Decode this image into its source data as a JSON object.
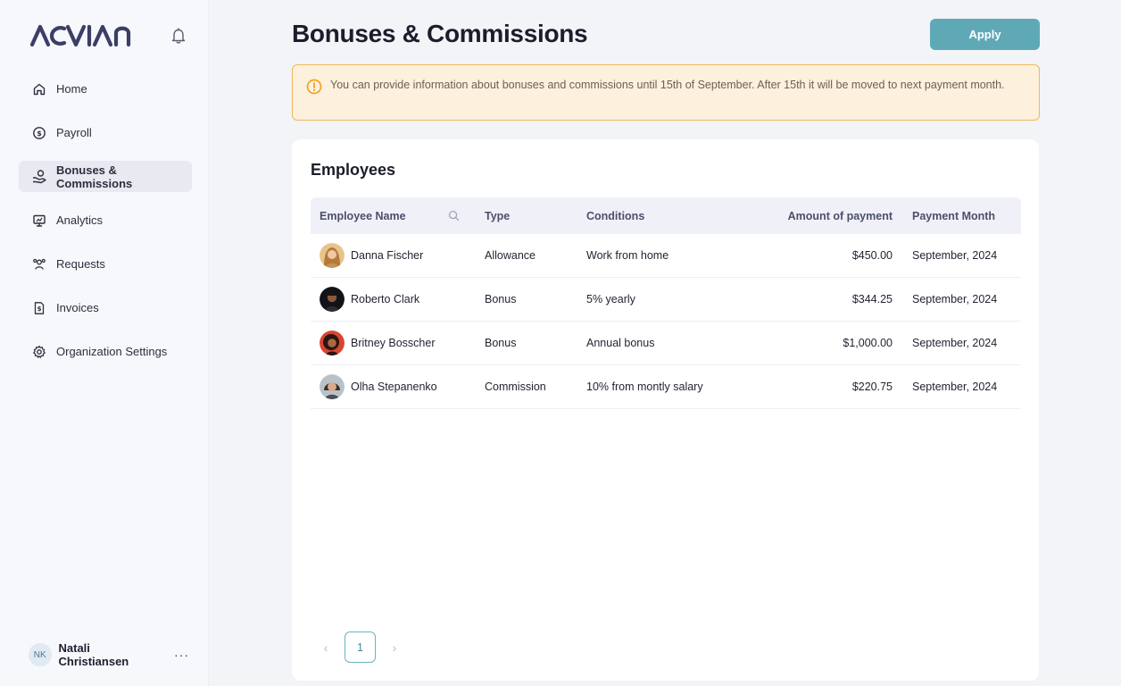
{
  "brand": {
    "logo_text": "ACVIAN",
    "logo_color": "#3b3f66"
  },
  "sidebar": {
    "items": [
      {
        "label": "Home",
        "icon": "home-icon"
      },
      {
        "label": "Payroll",
        "icon": "dollar-circle-icon"
      },
      {
        "label": "Bonuses & Commissions",
        "icon": "hand-coins-icon",
        "active": true
      },
      {
        "label": "Analytics",
        "icon": "presentation-chart-icon"
      },
      {
        "label": "Requests",
        "icon": "users-icon"
      },
      {
        "label": "Invoices",
        "icon": "invoice-dollar-icon"
      },
      {
        "label": "Organization Settings",
        "icon": "gear-icon"
      }
    ]
  },
  "user": {
    "initials": "NK",
    "name": "Natali Christiansen",
    "more": "···"
  },
  "header": {
    "title": "Bonuses & Commissions",
    "apply_label": "Apply"
  },
  "alert": {
    "text": "You can provide information about bonuses and commissions until 15th of September. After 15th it will be moved to next payment month.",
    "icon": "warning-circle-icon",
    "color": "#f2b758"
  },
  "employees": {
    "title": "Employees",
    "columns": [
      "Employee Name",
      "Type",
      "Conditions",
      "Amount of payment",
      "Payment Month"
    ],
    "rows": [
      {
        "name": "Danna Fischer",
        "type": "Allowance",
        "conditions": "Work from home",
        "amount": "$450.00",
        "month": "September, 2024"
      },
      {
        "name": "Roberto Clark",
        "type": "Bonus",
        "conditions": "5% yearly",
        "amount": "$344.25",
        "month": "September, 2024"
      },
      {
        "name": "Britney Bosscher",
        "type": "Bonus",
        "conditions": "Annual bonus",
        "amount": "$1,000.00",
        "month": "September, 2024"
      },
      {
        "name": "Olha Stepanenko",
        "type": "Commission",
        "conditions": "10% from montly salary",
        "amount": "$220.75",
        "month": "September, 2024"
      }
    ]
  },
  "pagination": {
    "current": "1",
    "prev": "‹",
    "next": "›"
  },
  "colors": {
    "accent": "#5fa9b7",
    "alert_bg": "#fdf0dd",
    "alert_border": "#f2b758"
  }
}
